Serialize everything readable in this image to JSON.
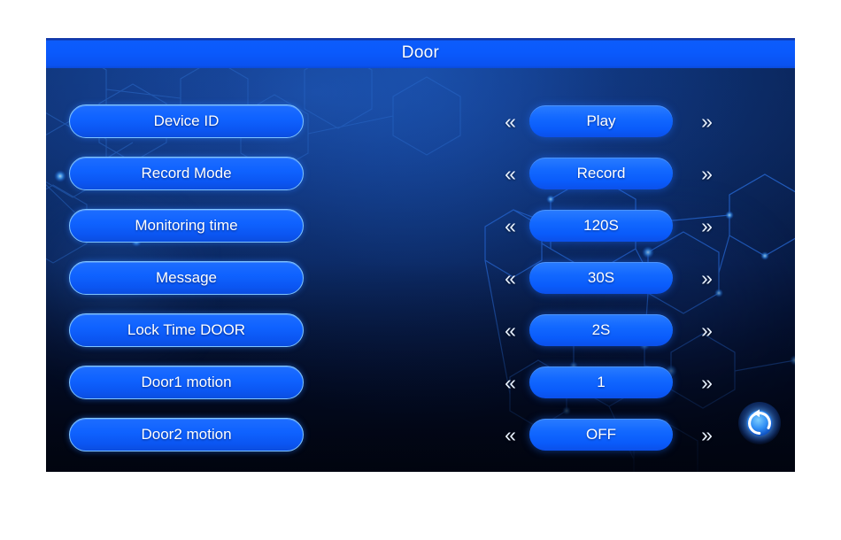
{
  "screen": {
    "title": "Door",
    "accent_color": "#0a5afd",
    "background_color": "#061436",
    "border_color": "#7fc4ff",
    "text_color": "#ffffff"
  },
  "nav": {
    "prev_glyph": "«",
    "next_glyph": "»",
    "prev_name": "previous-value",
    "next_name": "next-value"
  },
  "settings": {
    "rows": [
      {
        "label": "Device ID",
        "value": "Play"
      },
      {
        "label": "Record Mode",
        "value": "Record"
      },
      {
        "label": "Monitoring time",
        "value": "120S"
      },
      {
        "label": "Message",
        "value": "30S"
      },
      {
        "label": "Lock Time DOOR",
        "value": "2S"
      },
      {
        "label": "Door1 motion",
        "value": "1"
      },
      {
        "label": "Door2 motion",
        "value": "OFF"
      }
    ]
  },
  "footer": {
    "return_button_icon": "return-arrow-icon",
    "return_button_label": "Return"
  }
}
